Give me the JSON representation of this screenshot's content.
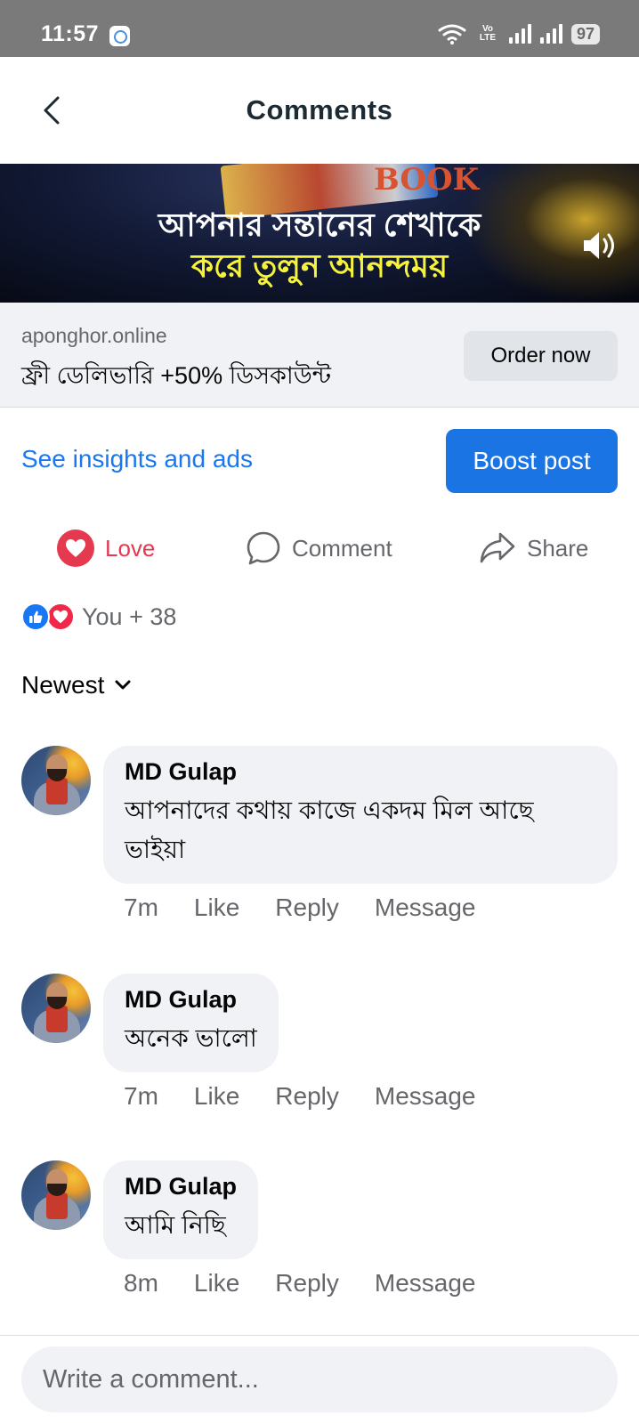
{
  "status_bar": {
    "time": "11:57",
    "network_label": "Vo LTE",
    "battery": "97"
  },
  "header": {
    "title": "Comments"
  },
  "ad": {
    "banner_line1": "আপনার সন্তানের শেখাকে",
    "banner_line2": "করে তুলুন আনন্দময়",
    "banner_product_text": "BOOK",
    "domain": "aponghor.online",
    "offer": "ফ্রী ডেলিভারি +50% ডিসকাউন্ট",
    "cta": "Order now"
  },
  "insights": {
    "link": "See insights and ads",
    "boost": "Boost post"
  },
  "actions": {
    "love": "Love",
    "comment": "Comment",
    "share": "Share"
  },
  "reactions": {
    "summary": "You + 38"
  },
  "sort": {
    "label": "Newest"
  },
  "comments": [
    {
      "author": "MD Gulap",
      "text": "আপনাদের কথায় কাজে একদম মিল আছে ভাইয়া",
      "time": "7m",
      "like": "Like",
      "reply": "Reply",
      "message": "Message"
    },
    {
      "author": "MD Gulap",
      "text": "অনেক ভালো",
      "time": "7m",
      "like": "Like",
      "reply": "Reply",
      "message": "Message"
    },
    {
      "author": "MD Gulap",
      "text": "আমি নিছি",
      "time": "8m",
      "like": "Like",
      "reply": "Reply",
      "message": "Message"
    }
  ],
  "composer": {
    "placeholder": "Write a comment..."
  },
  "colors": {
    "accent": "#1877f2",
    "boost_button": "#1b74e4",
    "love": "#e53950",
    "bubble": "#f0f2f5",
    "secondary_text": "#65676b"
  }
}
